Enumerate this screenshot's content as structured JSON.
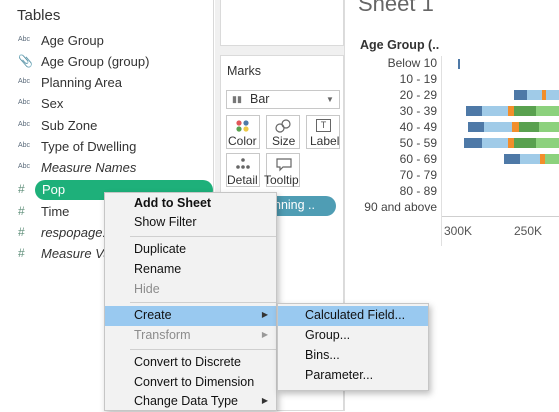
{
  "data_pane": {
    "header": "Tables",
    "fields": [
      {
        "icon": "Abc",
        "label": "Age Group",
        "italic": false
      },
      {
        "icon": "paperclip",
        "label": "Age Group (group)",
        "italic": false
      },
      {
        "icon": "Abc",
        "label": "Planning Area",
        "italic": false
      },
      {
        "icon": "Abc",
        "label": "Sex",
        "italic": false
      },
      {
        "icon": "Abc",
        "label": "Sub Zone",
        "italic": false
      },
      {
        "icon": "Abc",
        "label": "Type of Dwelling",
        "italic": false
      },
      {
        "icon": "Abc",
        "label": "Measure Names",
        "italic": true
      },
      {
        "icon": "#",
        "label": "Pop",
        "italic": false,
        "selected": true
      },
      {
        "icon": "#",
        "label": "Time",
        "italic": false
      },
      {
        "icon": "#",
        "label": "respopage...",
        "italic": true
      },
      {
        "icon": "#",
        "label": "Measure Va...",
        "italic": true
      }
    ]
  },
  "marks_card": {
    "title": "Marks",
    "mark_type": "Bar",
    "buttons": [
      "Color",
      "Size",
      "Label",
      "Detail",
      "Tooltip"
    ],
    "pill_label": "nning .."
  },
  "sheet": {
    "title": "Sheet 1",
    "column_header": "Age Group (..",
    "rows": [
      "Below 10",
      "10 - 19",
      "20 - 29",
      "30 - 39",
      "40 - 49",
      "50 - 59",
      "60 - 69",
      "70 - 79",
      "80 - 89",
      "90 and above"
    ],
    "axis_ticks": [
      "300K",
      "250K"
    ]
  },
  "context_menu": {
    "items": [
      {
        "label": "Add to Sheet",
        "bold": true,
        "disabled": false
      },
      {
        "label": "Show Filter",
        "disabled": false
      },
      {
        "label": "Duplicate",
        "disabled": false
      },
      {
        "label": "Rename",
        "disabled": false
      },
      {
        "label": "Hide",
        "disabled": true
      },
      {
        "label": "Create",
        "disabled": false,
        "submenu": true,
        "highlighted": true
      },
      {
        "label": "Transform",
        "disabled": true,
        "submenu": true
      },
      {
        "label": "Convert to Discrete",
        "disabled": false
      },
      {
        "label": "Convert to Dimension",
        "disabled": false
      },
      {
        "label": "Change Data Type",
        "disabled": false,
        "submenu": true
      }
    ]
  },
  "submenu": {
    "items": [
      {
        "label": "Calculated Field...",
        "highlighted": true
      },
      {
        "label": "Group..."
      },
      {
        "label": "Bins..."
      },
      {
        "label": "Parameter..."
      }
    ]
  },
  "colors": {
    "pop_pill": "#1eb07a",
    "planning_pill": "#4f9db4",
    "menu_highlight": "#99c9f0",
    "bar_palette": [
      "#4e79a7",
      "#a0cbe8",
      "#f28e2b",
      "#59a14f",
      "#8cd17d",
      "#a0cbe8"
    ]
  }
}
